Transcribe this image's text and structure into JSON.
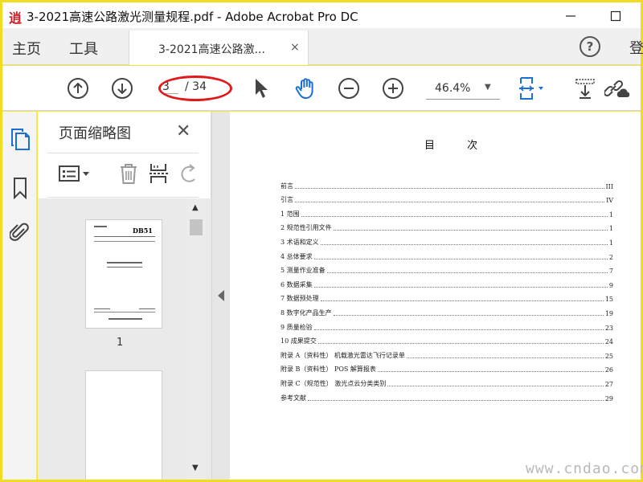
{
  "window": {
    "app_logo": "逍",
    "title": "3-2021高速公路激光测量规程.pdf - Adobe Acrobat Pro DC",
    "minimize_label": "—",
    "maximize_label": "□"
  },
  "nav": {
    "home": "主页",
    "tools": "工具",
    "doc_tab": "3-2021高速公路激...",
    "doc_tab_close": "×",
    "help": "?",
    "signin": "登"
  },
  "toolbar": {
    "page_current": "3",
    "page_total": "/ 34",
    "zoom": "46.4%",
    "zoom_caret": "▼"
  },
  "panel": {
    "title": "页面缩略图",
    "close": "✕",
    "thumbs": [
      {
        "number": "1",
        "header": "DB51"
      },
      {
        "number": ""
      }
    ],
    "scroll_up": "▲",
    "scroll_down": "▼"
  },
  "document": {
    "toc_title": "目  次",
    "toc": [
      {
        "label": "前言",
        "page": "III"
      },
      {
        "label": "引言",
        "page": "IV"
      },
      {
        "label": "1  范围",
        "page": "1"
      },
      {
        "label": "2  规范性引用文件",
        "page": "1"
      },
      {
        "label": "3  术语和定义",
        "page": "1"
      },
      {
        "label": "4  总体要求",
        "page": "2"
      },
      {
        "label": "5  测量作业准备",
        "page": "7"
      },
      {
        "label": "6  数据采集",
        "page": "9"
      },
      {
        "label": "7  数据预处理",
        "page": "15"
      },
      {
        "label": "8  数字化产品生产",
        "page": "19"
      },
      {
        "label": "9  质量检验",
        "page": "23"
      },
      {
        "label": "10  成果提交",
        "page": "24"
      },
      {
        "label": "附录 A（资料性）  机载激光雷达飞行记录单",
        "page": "25"
      },
      {
        "label": "附录 B（资料性）  POS 解算报表",
        "page": "26"
      },
      {
        "label": "附录 C（规范性）  激光点云分类类别",
        "page": "27"
      },
      {
        "label": "参考文献",
        "page": "29"
      }
    ],
    "watermark": "www.cndao.com"
  },
  "colors": {
    "frame": "#f2dc1f",
    "annotation_oval": "#e0191b",
    "icon": "#444444"
  }
}
